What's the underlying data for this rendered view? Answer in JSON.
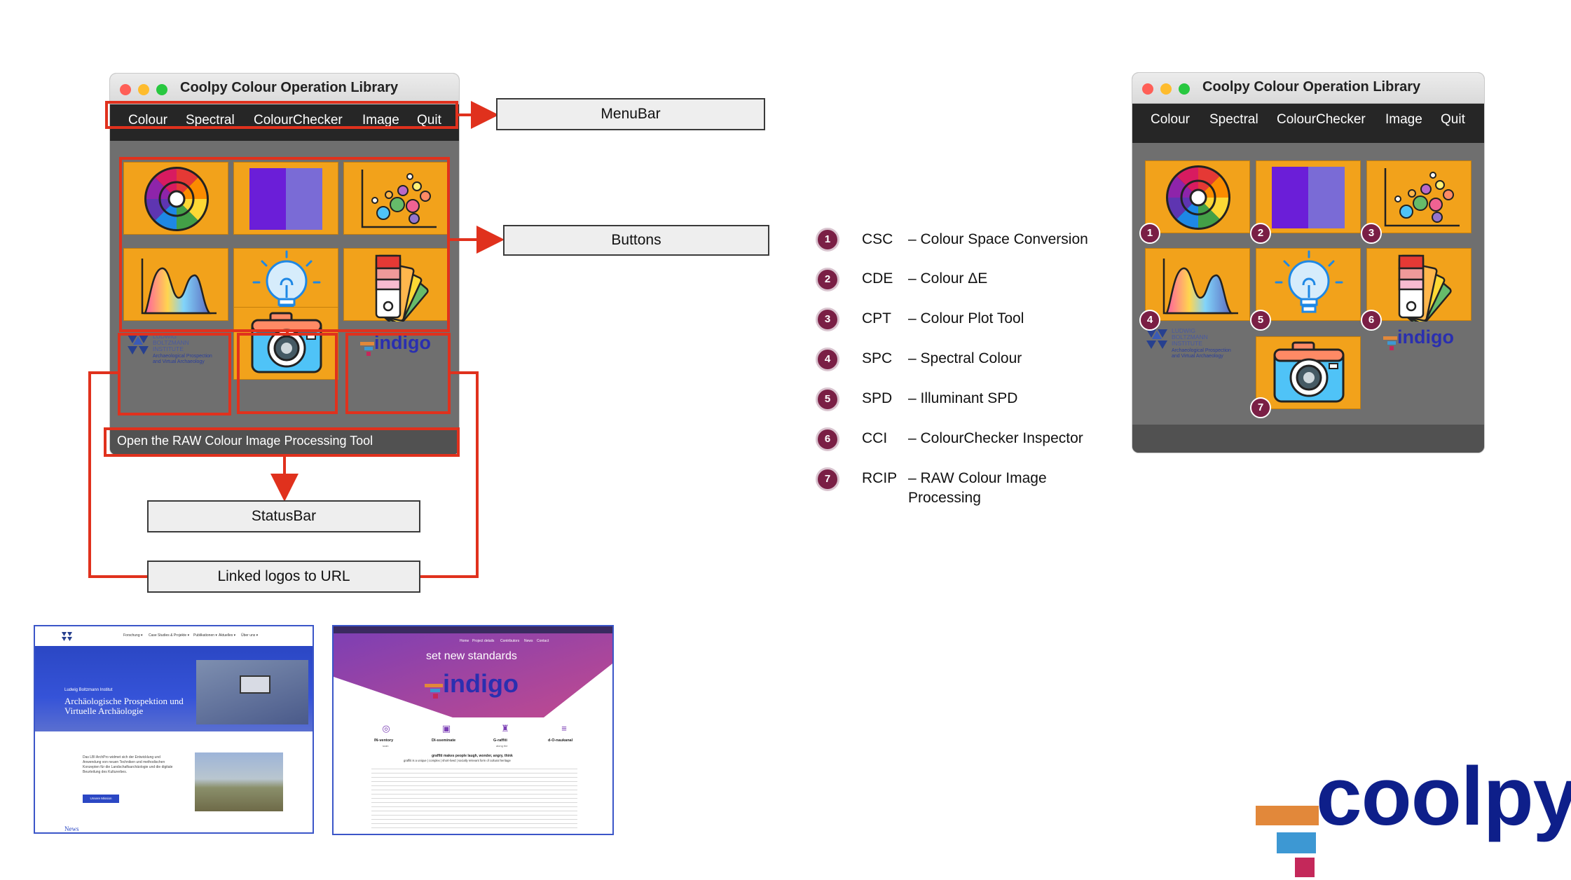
{
  "window": {
    "title": "Coolpy Colour Operation Library",
    "menu": [
      "Colour",
      "Spectral",
      "ColourChecker",
      "Image",
      "Quit"
    ],
    "status": "Open the RAW Colour Image Processing Tool"
  },
  "annotations": {
    "menubar": "MenuBar",
    "buttons": "Buttons",
    "statusbar": "StatusBar",
    "logos": "Linked logos to URL"
  },
  "logo_text": {
    "lbi_line1": "LUDWIG",
    "lbi_line2": "BOLTZMANN",
    "lbi_line3": "INSTITUTE",
    "lbi_line4": "Archaeological Prospection",
    "lbi_line5": "and Virtual Archaeology",
    "indigo": "indigo"
  },
  "legend": [
    {
      "num": "1",
      "code": "CSC",
      "desc": "– Colour Space Conversion"
    },
    {
      "num": "2",
      "code": "CDE",
      "desc": "– Colour ΔE"
    },
    {
      "num": "3",
      "code": "CPT",
      "desc": "– Colour Plot Tool"
    },
    {
      "num": "4",
      "code": "SPC",
      "desc": "– Spectral Colour"
    },
    {
      "num": "5",
      "code": "SPD",
      "desc": "– Illuminant SPD"
    },
    {
      "num": "6",
      "code": "CCI",
      "desc": "– ColourChecker Inspector"
    },
    {
      "num": "7",
      "code": "RCIP",
      "desc": "– RAW Colour Image",
      "desc2": "Processing"
    }
  ],
  "site_lbi": {
    "hero_small": "Ludwig Boltzmann Institut",
    "hero_title": "Archäologische Prospektion und Virtuelle Archäologie",
    "nav": [
      "Forschung ▾",
      "Case Studies & Projekte ▾",
      "Publikationen ▾",
      "Aktuelles ▾",
      "Über uns ▾"
    ],
    "body": "Das LBI ArchPro widmet sich der Entwicklung und Anwendung von neuen Techniken und methodischen Konzepten für die Landschaftsarchäologie und die digitale Beurteilung des Kulturerbes.",
    "button": "Unsere Mission",
    "news": "News"
  },
  "site_indigo": {
    "nav": [
      "Home",
      "Project details",
      "Contributors",
      "News",
      "Contact"
    ],
    "headline": "set new standards",
    "logo": "indigo",
    "features": [
      {
        "title": "IN-ventory",
        "sub": "scan"
      },
      {
        "title": "DI-sseminate",
        "sub": ""
      },
      {
        "title": "G-raffiti",
        "sub": "along the"
      },
      {
        "title": "d-O-naukanal",
        "sub": ""
      }
    ],
    "tagline": "graffiti makes people laugh, wonder, angry, think",
    "tagline2": "graffiti is a unique | complex | short-lived | socially relevant form of cultural heritage"
  },
  "brand": {
    "wordmark": "coolpy",
    "colors": {
      "orange": "#e2883a",
      "blue": "#3d98d3",
      "magenta": "#c4285a",
      "navy": "#0e1f8a"
    }
  },
  "accent": {
    "annotation_red": "#e0311d",
    "tile_orange": "#f2a21b",
    "badge": "#7a1f45"
  }
}
